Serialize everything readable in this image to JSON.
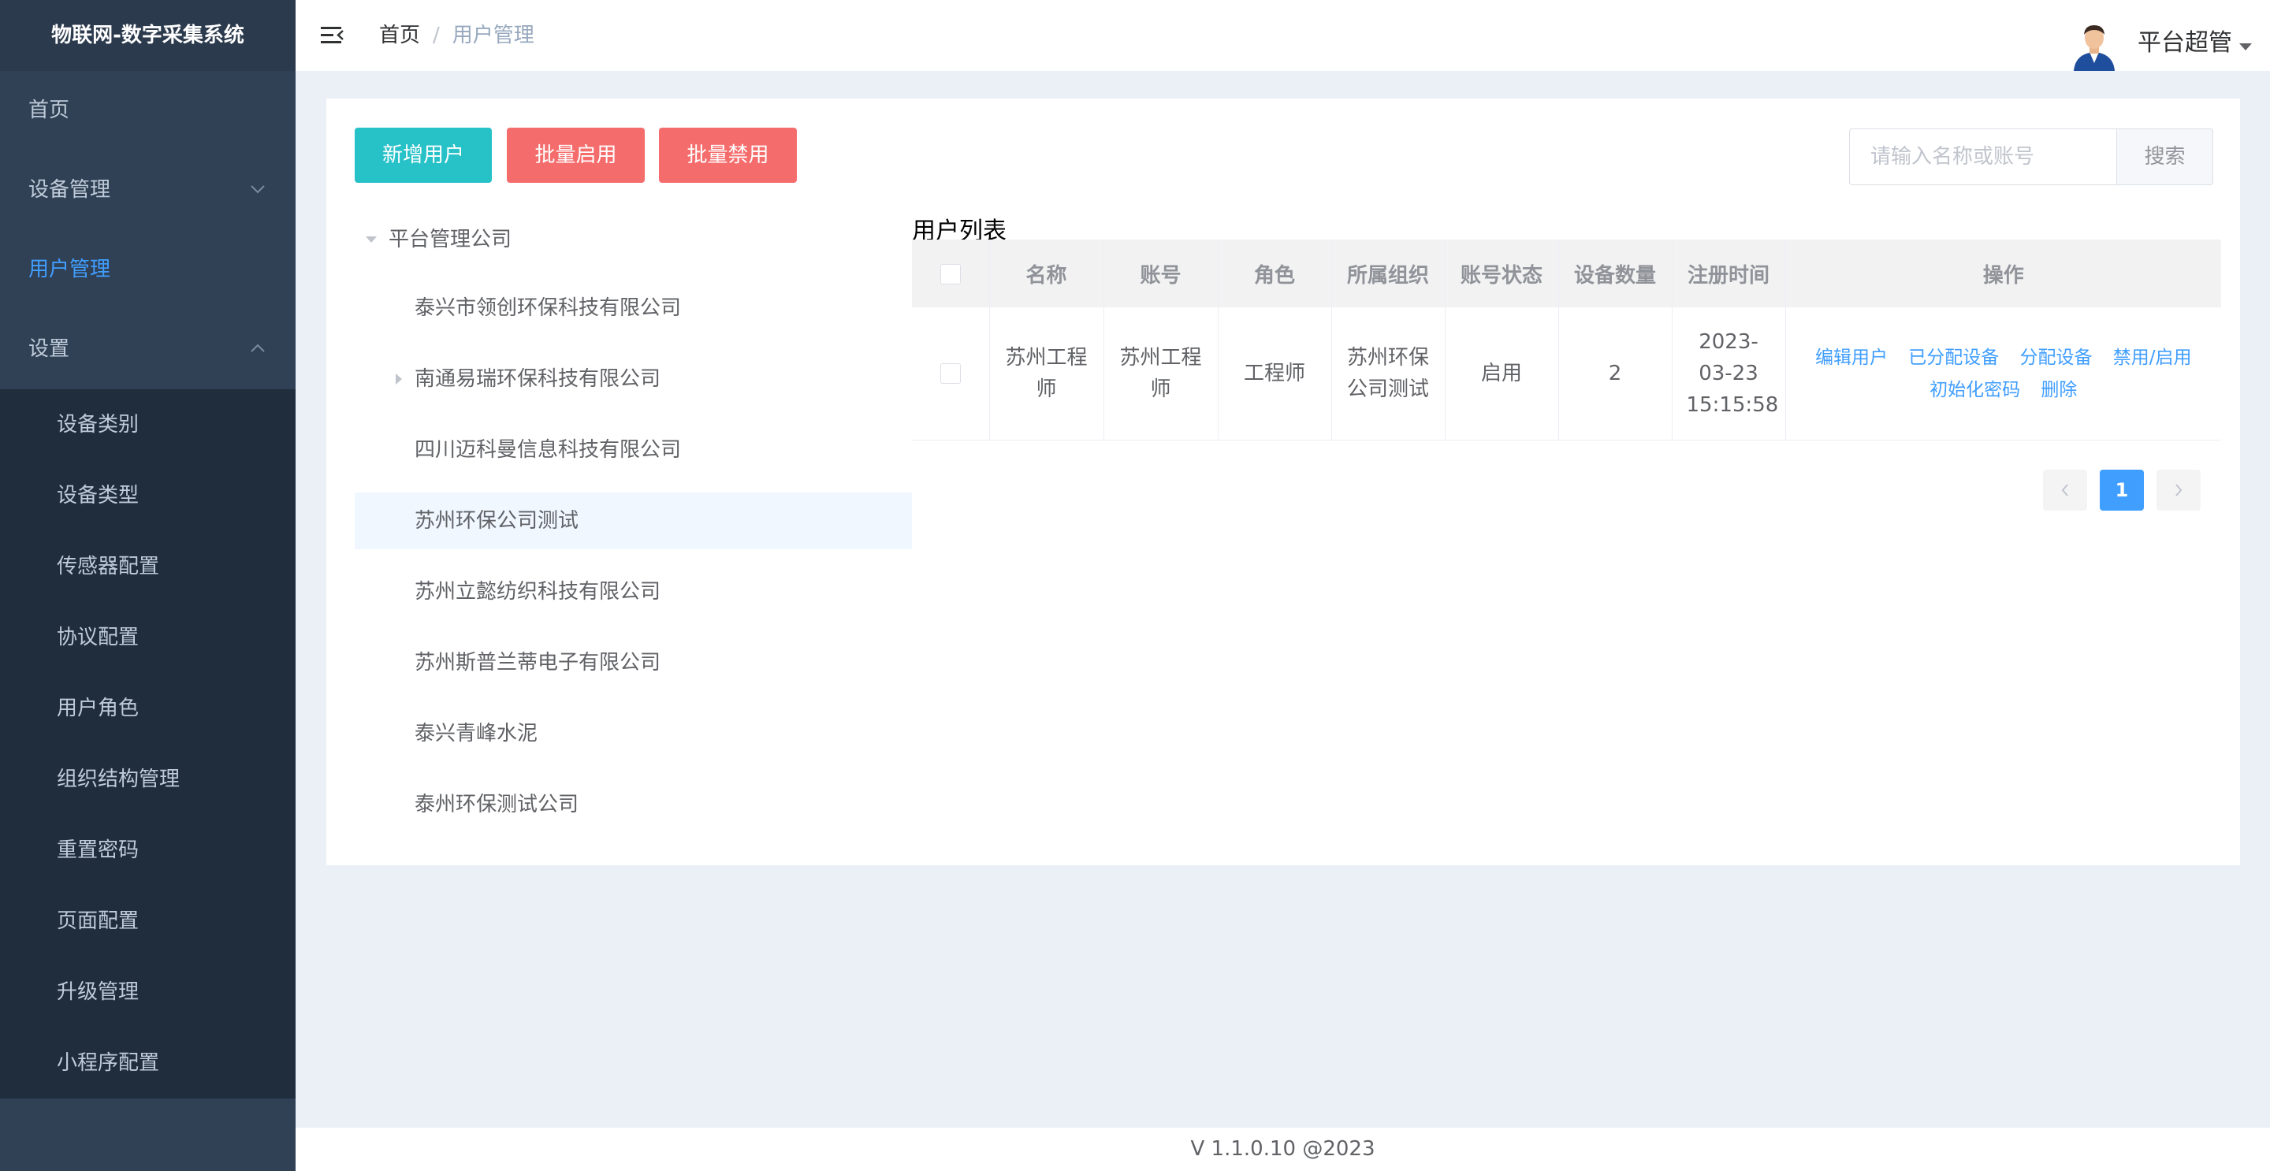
{
  "app": {
    "title": "物联网-数字采集系统"
  },
  "sidebar": {
    "menu": [
      {
        "label": "首页"
      },
      {
        "label": "设备管理"
      },
      {
        "label": "用户管理"
      },
      {
        "label": "设置"
      }
    ],
    "settings_items": [
      "设备类别",
      "设备类型",
      "传感器配置",
      "协议配置",
      "用户角色",
      "组织结构管理",
      "重置密码",
      "页面配置",
      "升级管理",
      "小程序配置"
    ]
  },
  "header": {
    "breadcrumb": {
      "home": "首页",
      "separator": "/",
      "current": "用户管理"
    },
    "username": "平台超管"
  },
  "toolbar": {
    "add_user": "新增用户",
    "batch_enable": "批量启用",
    "batch_disable": "批量禁用"
  },
  "search": {
    "placeholder": "请输入名称或账号",
    "button": "搜索"
  },
  "tree": {
    "root": "平台管理公司",
    "nodes": [
      "泰兴市领创环保科技有限公司",
      "南通易瑞环保科技有限公司",
      "四川迈科曼信息科技有限公司",
      "苏州环保公司测试",
      "苏州立懿纺织科技有限公司",
      "苏州斯普兰蒂电子有限公司",
      "泰兴青峰水泥",
      "泰州环保测试公司"
    ],
    "selected": "苏州环保公司测试"
  },
  "user_list": {
    "title": "用户列表",
    "columns": [
      "名称",
      "账号",
      "角色",
      "所属组织",
      "账号状态",
      "设备数量",
      "注册时间",
      "操作"
    ],
    "rows": [
      {
        "name": "苏州工程师",
        "account": "苏州工程师",
        "role": "工程师",
        "org": "苏州环保公司测试",
        "status": "启用",
        "device_count": "2",
        "registered": "2023-03-23 15:15:58"
      }
    ],
    "actions": [
      "编辑用户",
      "已分配设备",
      "分配设备",
      "禁用/启用",
      "初始化密码",
      "删除"
    ]
  },
  "pagination": {
    "current_page": "1"
  },
  "footer": {
    "version": "V 1.1.0.10 @2023"
  },
  "colors": {
    "sidebar_bg": "#304156",
    "submenu_bg": "#1f2d3d",
    "active_menu": "#409eff",
    "add_button": "#27c1c8",
    "danger_button": "#f56c6c",
    "link": "#409eff"
  }
}
